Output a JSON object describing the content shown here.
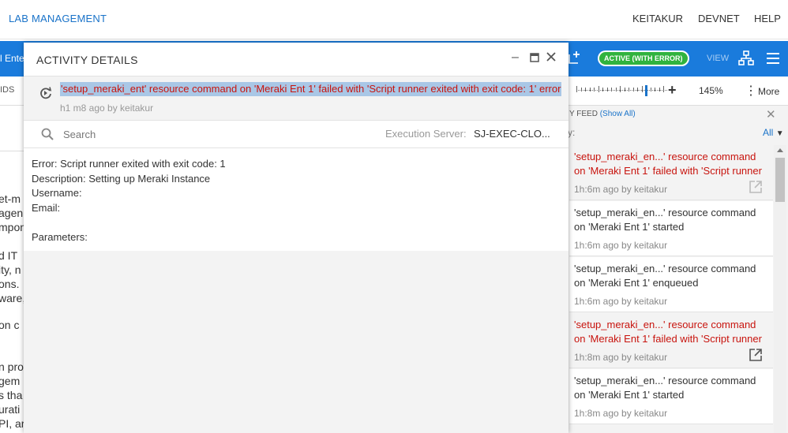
{
  "topnav": {
    "brand": "LAB MANAGEMENT",
    "items": [
      "KEITAKUR",
      "DEVNET",
      "HELP"
    ]
  },
  "bluebar": {
    "left_text": "l Ente",
    "status_badge": "ACTIVE (WITH ERROR)",
    "view_label": "VIEW"
  },
  "toolbar2": {
    "left_text": "IDS",
    "zoom_percent": "145%",
    "more_label": "More"
  },
  "background_page": {
    "lines": [
      "et-m",
      "agen",
      "mpon",
      "d IT",
      "ity, n",
      "ons.",
      "ware,",
      "on c",
      "n pro",
      "gem",
      "s tha",
      "urati",
      "PI, ar"
    ]
  },
  "modal": {
    "title": "ACTIVITY DETAILS",
    "error_message": "'setup_meraki_ent' resource command on 'Meraki Ent 1' failed with 'Script runner exited with exit code: 1' error",
    "time_meta": "h1 m8 ago by keitakur",
    "search_placeholder": "Search",
    "execution_server_label": "Execution Server:",
    "execution_server_value": "SJ-EXEC-CLO...",
    "details": [
      "Error: Script runner exited with exit code: 1",
      "Description: Setting up Meraki Instance",
      "Username:",
      "Email:",
      "",
      "Parameters:"
    ]
  },
  "feed": {
    "title_prefix": "Y FEED",
    "show_all": "(Show All)",
    "filter_colon": "y:",
    "filter_value": "All",
    "items": [
      {
        "line1": "'setup_meraki_en...' resource command",
        "line2": "on 'Meraki Ent 1' failed with 'Script runner",
        "meta": "1h:6m ago by keitakur",
        "error": true,
        "has_link": true
      },
      {
        "line1": "'setup_meraki_en...' resource command",
        "line2": "on 'Meraki Ent 1' started",
        "meta": "1h:6m ago by keitakur",
        "error": false,
        "has_link": false
      },
      {
        "line1": "'setup_meraki_en...' resource command",
        "line2": "on 'Meraki Ent 1' enqueued",
        "meta": "1h:6m ago by keitakur",
        "error": false,
        "has_link": false
      },
      {
        "line1": "'setup_meraki_en...' resource command",
        "line2": "on 'Meraki Ent 1' failed with 'Script runner",
        "meta": "1h:8m ago by keitakur",
        "error": true,
        "has_link": true
      },
      {
        "line1": "'setup_meraki_en...' resource command",
        "line2": "on 'Meraki Ent 1' started",
        "meta": "1h:8m ago by keitakur",
        "error": false,
        "has_link": false
      }
    ]
  },
  "colors": {
    "brand_blue": "#1a73c9",
    "toolbar_blue": "#1a7bdc",
    "active_green": "#30b33e",
    "error_red": "#c8140e",
    "selection_blue": "#a9c7e6"
  }
}
